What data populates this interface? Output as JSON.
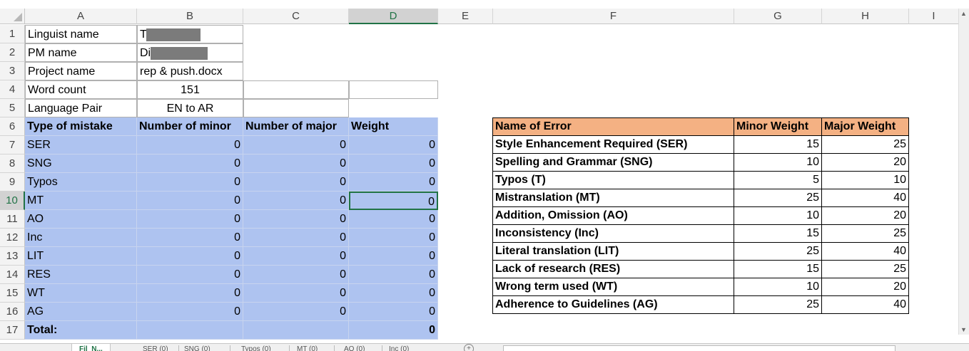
{
  "columns": [
    "A",
    "B",
    "C",
    "D",
    "E",
    "F",
    "G",
    "H",
    "I"
  ],
  "selected_column": "D",
  "selected_row": "10",
  "rows": [
    "1",
    "2",
    "3",
    "4",
    "5",
    "6",
    "7",
    "8",
    "9",
    "10",
    "11",
    "12",
    "13",
    "14",
    "15",
    "16",
    "17"
  ],
  "info": {
    "linguist_label": "Linguist name",
    "linguist_value": "T",
    "pm_label": "PM name",
    "pm_value": "Di",
    "project_label": "Project name",
    "project_value": "rep & push.docx",
    "wordcount_label": "Word count",
    "wordcount_value": "151",
    "langpair_label": "Language Pair",
    "langpair_value": "EN to AR"
  },
  "mistakes": {
    "headers": [
      "Type of mistake",
      "Number of minor",
      "Number of major",
      "Weight"
    ],
    "rows": [
      {
        "type": "SER",
        "minor": "0",
        "major": "0",
        "weight": "0"
      },
      {
        "type": "SNG",
        "minor": "0",
        "major": "0",
        "weight": "0"
      },
      {
        "type": "Typos",
        "minor": "0",
        "major": "0",
        "weight": "0"
      },
      {
        "type": "MT",
        "minor": "0",
        "major": "0",
        "weight": "0"
      },
      {
        "type": "AO",
        "minor": "0",
        "major": "0",
        "weight": "0"
      },
      {
        "type": "Inc",
        "minor": "0",
        "major": "0",
        "weight": "0"
      },
      {
        "type": "LIT",
        "minor": "0",
        "major": "0",
        "weight": "0"
      },
      {
        "type": "RES",
        "minor": "0",
        "major": "0",
        "weight": "0"
      },
      {
        "type": "WT",
        "minor": "0",
        "major": "0",
        "weight": "0"
      },
      {
        "type": "AG",
        "minor": "0",
        "major": "0",
        "weight": "0"
      }
    ],
    "total_label": "Total:",
    "total_value": "0"
  },
  "errors": {
    "headers": [
      "Name of Error",
      "Minor Weight",
      "Major Weight"
    ],
    "rows": [
      {
        "name": "Style Enhancement Required (SER)",
        "minor": "15",
        "major": "25"
      },
      {
        "name": "Spelling and Grammar (SNG)",
        "minor": "10",
        "major": "20"
      },
      {
        "name": "Typos (T)",
        "minor": "5",
        "major": "10"
      },
      {
        "name": "Mistranslation (MT)",
        "minor": "25",
        "major": "40"
      },
      {
        "name": "Addition, Omission (AO)",
        "minor": "10",
        "major": "20"
      },
      {
        "name": "Inconsistency (Inc)",
        "minor": "15",
        "major": "25"
      },
      {
        "name": "Literal translation (LIT)",
        "minor": "25",
        "major": "40"
      },
      {
        "name": "Lack of research (RES)",
        "minor": "15",
        "major": "25"
      },
      {
        "name": "Wrong term used (WT)",
        "minor": "10",
        "major": "20"
      },
      {
        "name": "Adherence to Guidelines (AG)",
        "minor": "25",
        "major": "40"
      }
    ]
  },
  "tabs": [
    "Fil_N...",
    "SER (0)",
    "SNG (0)",
    "Typos (0)",
    "MT (0)",
    "AO (0)",
    "Inc (0)"
  ],
  "colors": {
    "accent": "#217346",
    "selection": "#aec3f0",
    "table_header": "#f4b183"
  }
}
